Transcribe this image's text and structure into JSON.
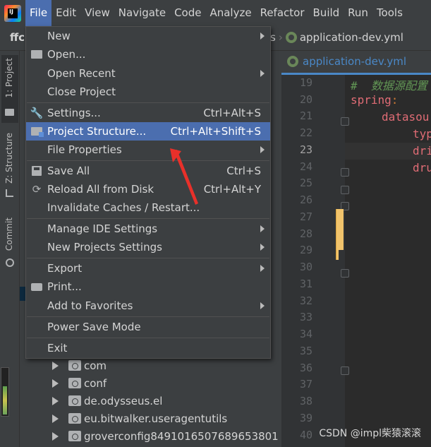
{
  "menubar": {
    "items": [
      "File",
      "Edit",
      "View",
      "Navigate",
      "Code",
      "Analyze",
      "Refactor",
      "Build",
      "Run",
      "Tools"
    ],
    "active_index": 0
  },
  "navbar": {
    "project_name": "ffc",
    "crumb_tail": "s",
    "file_name": "application-dev.yml"
  },
  "toolstrip": {
    "tabs": [
      "1: Project",
      "Z: Structure",
      "Commit"
    ]
  },
  "editor": {
    "tab_title": "application-dev.yml",
    "line_numbers": [
      "19",
      "20",
      "21",
      "22",
      "23",
      "24",
      "25",
      "26",
      "27",
      "28",
      "29",
      "30",
      "31",
      "32",
      "33",
      "34",
      "35",
      "36",
      "37",
      "38",
      "39",
      "40"
    ],
    "current_line": "23",
    "comment": "#  数据源配置",
    "key_spring": "spring",
    "colon": ":",
    "key_datasource": "datasou",
    "key_type": "typ",
    "key_driver": "dri",
    "key_druid": "dru"
  },
  "tree": {
    "items": [
      "com",
      "conf",
      "de.odysseus.el",
      "eu.bitwalker.useragentutils",
      "groverconfig8491016507689653801"
    ]
  },
  "file_menu": {
    "items": [
      {
        "label": "New",
        "shortcut": "",
        "submenu": true,
        "icon": ""
      },
      {
        "label": "Open...",
        "shortcut": "",
        "submenu": false,
        "icon": "folder-open-icon"
      },
      {
        "label": "Open Recent",
        "shortcut": "",
        "submenu": true,
        "icon": ""
      },
      {
        "label": "Close Project",
        "shortcut": "",
        "submenu": false,
        "icon": ""
      },
      {
        "label": "Settings...",
        "shortcut": "Ctrl+Alt+S",
        "submenu": false,
        "icon": "wrench-icon"
      },
      {
        "label": "Project Structure...",
        "shortcut": "Ctrl+Alt+Shift+S",
        "submenu": false,
        "icon": "project-structure-icon",
        "selected": true
      },
      {
        "label": "File Properties",
        "shortcut": "",
        "submenu": true,
        "icon": ""
      },
      {
        "label": "Save All",
        "shortcut": "Ctrl+S",
        "submenu": false,
        "icon": "save-icon"
      },
      {
        "label": "Reload All from Disk",
        "shortcut": "Ctrl+Alt+Y",
        "submenu": false,
        "icon": "reload-icon"
      },
      {
        "label": "Invalidate Caches / Restart...",
        "shortcut": "",
        "submenu": false,
        "icon": ""
      },
      {
        "label": "Manage IDE Settings",
        "shortcut": "",
        "submenu": true,
        "icon": ""
      },
      {
        "label": "New Projects Settings",
        "shortcut": "",
        "submenu": true,
        "icon": ""
      },
      {
        "label": "Export",
        "shortcut": "",
        "submenu": true,
        "icon": ""
      },
      {
        "label": "Print...",
        "shortcut": "",
        "submenu": false,
        "icon": "print-icon"
      },
      {
        "label": "Add to Favorites",
        "shortcut": "",
        "submenu": true,
        "icon": ""
      },
      {
        "label": "Power Save Mode",
        "shortcut": "",
        "submenu": false,
        "icon": ""
      },
      {
        "label": "Exit",
        "shortcut": "",
        "submenu": false,
        "icon": ""
      }
    ]
  },
  "watermark": "CSDN @impl柴猿滚滚",
  "colors": {
    "selection": "#4b6eaf",
    "panel": "#3c3f41",
    "editor_bg": "#2b2b2b",
    "annotation": "#e8302a",
    "yaml_key": "#cc7832",
    "keyword_red": "#e06c75"
  }
}
